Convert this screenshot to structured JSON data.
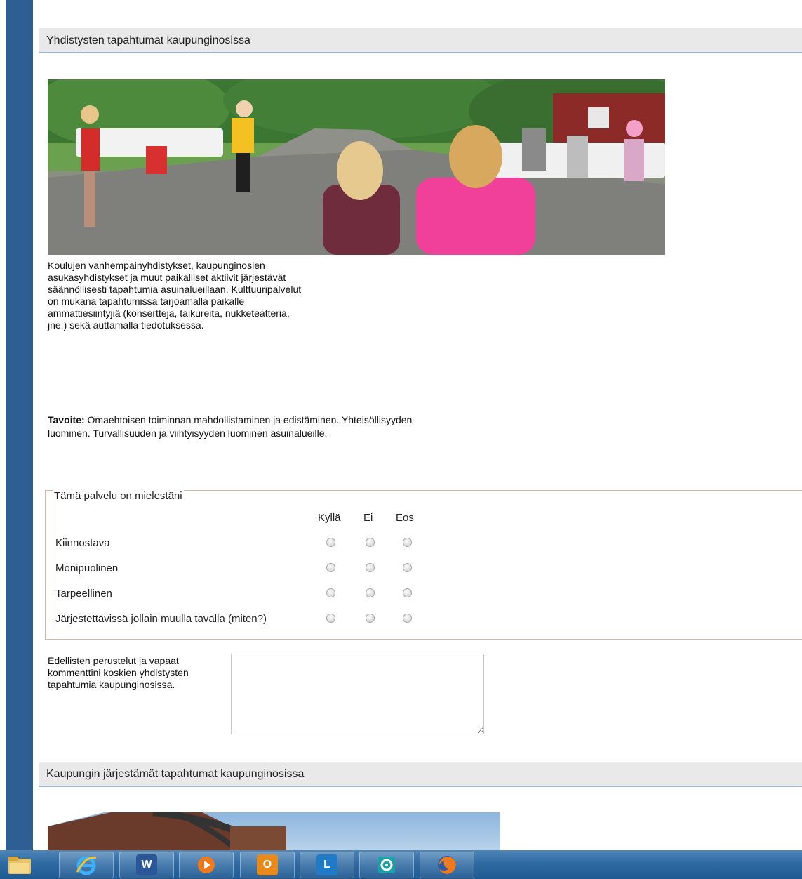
{
  "section1": {
    "title": "Yhdistysten tapahtumat kaupunginosissa",
    "description": "Koulujen vanhempainyhdistykset, kaupunginosien asukasyhdistykset ja muut paikalliset aktiivit järjestävät säännöllisesti tapahtumia asuinalueillaan. Kulttuuripalvelut on mukana tapahtumissa tarjoamalla paikalle ammattiesiintyjiä (konsertteja, taikureita, nukketeatteria, jne.) sekä auttamalla tiedotuksessa.",
    "goal_label": "Tavoite:",
    "goal_text": " Omaehtoisen toiminnan mahdollistaminen ja edistäminen. Yhteisöllisyyden luominen. Turvallisuuden ja viihtyisyyden luominen asuinalueille."
  },
  "rating": {
    "legend": "Tämä palvelu on mielestäni",
    "columns": [
      "Kyllä",
      "Ei",
      "Eos"
    ],
    "rows": [
      "Kiinnostava",
      "Monipuolinen",
      "Tarpeellinen",
      "Järjestettävissä jollain muulla tavalla (miten?)"
    ]
  },
  "comment": {
    "label": "Edellisten perustelut ja vapaat kommenttini koskien yhdistysten tapahtumia kaupunginosissa.",
    "value": ""
  },
  "section2": {
    "title": "Kaupungin järjestämät tapahtumat kaupunginosissa"
  },
  "taskbar": {
    "items": [
      {
        "name": "folder-icon"
      },
      {
        "name": "internet-explorer-icon"
      },
      {
        "name": "word-icon",
        "glyph": "W"
      },
      {
        "name": "media-player-icon"
      },
      {
        "name": "outlook-icon",
        "glyph": "O"
      },
      {
        "name": "lync-icon",
        "glyph": "L"
      },
      {
        "name": "app-icon"
      },
      {
        "name": "firefox-icon"
      }
    ]
  },
  "colors": {
    "sidebar": "#2d5f93",
    "header_bg": "#e9e9e9",
    "fieldset_border": "#d9b4a0",
    "taskbar": "#2f6aa2"
  }
}
